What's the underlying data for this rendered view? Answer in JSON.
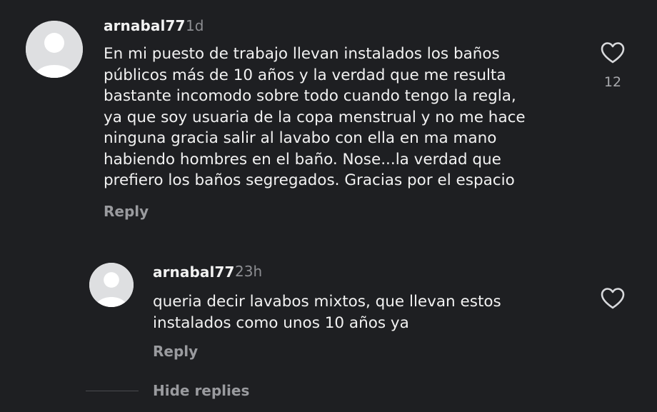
{
  "comments": [
    {
      "username": "arnabal77",
      "time": "1d",
      "lines": [
        "En mi puesto de trabajo llevan instalados los baños",
        "públicos más de 10 años y la verdad que me resulta",
        "bastante incomodo sobre todo cuando tengo la regla,",
        "ya que soy usuaria de la copa menstrual y no me hace",
        "ninguna gracia salir al lavabo con ella en ma mano",
        "habiendo hombres en el baño. Nose...la verdad que",
        "prefiero los baños segregados. Gracias por el espacio"
      ],
      "reply_label": "Reply",
      "likes": "12",
      "avatar_icon": "default-user-avatar",
      "like_icon": "heart-outline-icon"
    },
    {
      "username": "arnabal77",
      "time": "23h",
      "lines": [
        "queria decir lavabos mixtos, que llevan estos",
        "instalados como unos 10 años ya"
      ],
      "reply_label": "Reply",
      "avatar_icon": "default-user-avatar",
      "like_icon": "heart-outline-icon"
    }
  ],
  "hide_replies_label": "Hide replies",
  "colors": {
    "background": "#1e1f22",
    "text": "#f2f2f2",
    "muted": "#8d8e92",
    "avatar": "#dedfe1"
  }
}
